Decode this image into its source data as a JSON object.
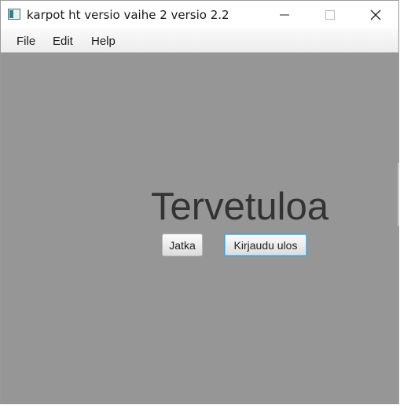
{
  "window": {
    "title": "karpot ht versio vaihe 2 versio 2.2",
    "controls": {
      "minimize": "minimize-icon",
      "maximize": "maximize-icon",
      "close": "close-icon"
    }
  },
  "menubar": {
    "items": [
      "File",
      "Edit",
      "Help"
    ]
  },
  "main": {
    "welcome_text": "Tervetuloa",
    "continue_label": "Jatka",
    "logout_label": "Kirjaudu ulos"
  },
  "colors": {
    "content_background": "#969696",
    "focus_border": "#3a9ed8"
  }
}
